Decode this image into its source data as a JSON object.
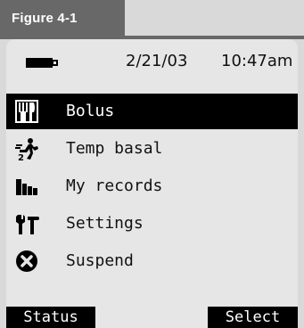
{
  "figure": {
    "label": "Figure 4-1"
  },
  "status_bar": {
    "battery_icon": "battery-icon",
    "date": "2/21/03",
    "time": "10:47am"
  },
  "menu": {
    "items": [
      {
        "label": "Bolus",
        "icon": "bolus-icon",
        "selected": true
      },
      {
        "label": "Temp basal",
        "icon": "temp-basal-icon",
        "selected": false
      },
      {
        "label": "My records",
        "icon": "records-icon",
        "selected": false
      },
      {
        "label": "Settings",
        "icon": "settings-icon",
        "selected": false
      },
      {
        "label": "Suspend",
        "icon": "suspend-icon",
        "selected": false
      }
    ]
  },
  "softkeys": {
    "left": "Status",
    "right": "Select"
  },
  "colors": {
    "frame": "#d9d9d9",
    "tab": "#686868",
    "screen": "#e6e6e6",
    "highlight": "#000000"
  }
}
